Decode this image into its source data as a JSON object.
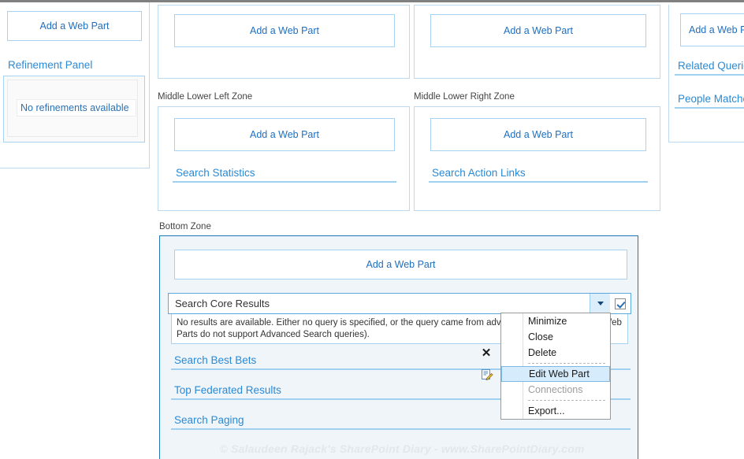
{
  "left_column": {
    "add_web_part": "Add a Web Part",
    "refinement_panel_title": "Refinement Panel",
    "refinement_message": "No refinements available"
  },
  "middle_upper": {
    "left_add_web_part": "Add a Web Part",
    "right_add_web_part": "Add a Web Part"
  },
  "middle_lower": {
    "left_zone_label": "Middle Lower Left Zone",
    "right_zone_label": "Middle Lower Right Zone",
    "left_add_web_part": "Add a Web Part",
    "right_add_web_part": "Add a Web Part",
    "search_statistics_title": "Search Statistics",
    "search_action_links_title": "Search Action Links"
  },
  "right_column": {
    "add_web_part": "Add a Web Part",
    "related_queries_title": "Related Queries",
    "people_matches_title": "People Matches"
  },
  "bottom_zone": {
    "zone_label": "Bottom Zone",
    "add_web_part": "Add a Web Part",
    "selected_web_part": {
      "title": "Search Core Results",
      "body_text": "No results are available. Either no query is specified, or the query came from advanced search (and these Web Parts do not support Advanced Search queries).",
      "menu_caret": "caret-down-icon",
      "checkbox_checked": true
    },
    "web_parts": [
      {
        "title": "Search Best Bets"
      },
      {
        "title": "Top Federated Results"
      },
      {
        "title": "Search Paging"
      }
    ]
  },
  "context_menu": {
    "items": [
      {
        "label": "Minimize",
        "icon": null,
        "state": "normal"
      },
      {
        "label": "Close",
        "icon": null,
        "state": "normal"
      },
      {
        "label": "Delete",
        "icon": "close-x-icon",
        "state": "normal"
      },
      {
        "label": "Edit Web Part",
        "icon": "edit-pencil-icon",
        "state": "selected"
      },
      {
        "label": "Connections",
        "icon": null,
        "state": "disabled"
      },
      {
        "label": "Export...",
        "icon": null,
        "state": "normal"
      }
    ]
  },
  "watermark": {
    "text": "© Salaudeen Rajack's SharePoint Diary - www.SharePointDiary.com"
  },
  "colors": {
    "link_blue": "#2a8ad4",
    "zone_border_blue": "#bcd9f0",
    "bottom_zone_border": "#1f78b4",
    "bottom_zone_fill": "#f0f5fa",
    "menu_highlight": "#d6ebfb"
  }
}
